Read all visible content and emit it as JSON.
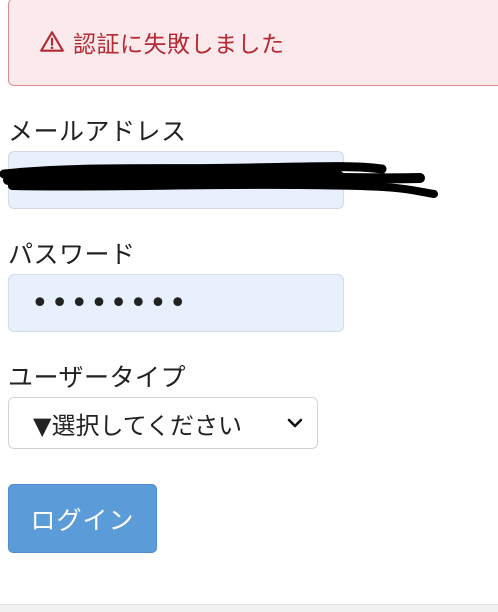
{
  "alert": {
    "icon": "warning-triangle-icon",
    "message": "認証に失敗しました",
    "color": "#b52a35"
  },
  "form": {
    "email": {
      "label": "メールアドレス",
      "value": ""
    },
    "password": {
      "label": "パスワード",
      "value": "••••••••"
    },
    "user_type": {
      "label": "ユーザータイプ",
      "selected": "▼選択してください"
    },
    "login_label": "ログイン"
  },
  "colors": {
    "button": "#5a9bd8",
    "autofill_bg": "#e8f0fe",
    "alert_bg": "#fbe9eb"
  }
}
